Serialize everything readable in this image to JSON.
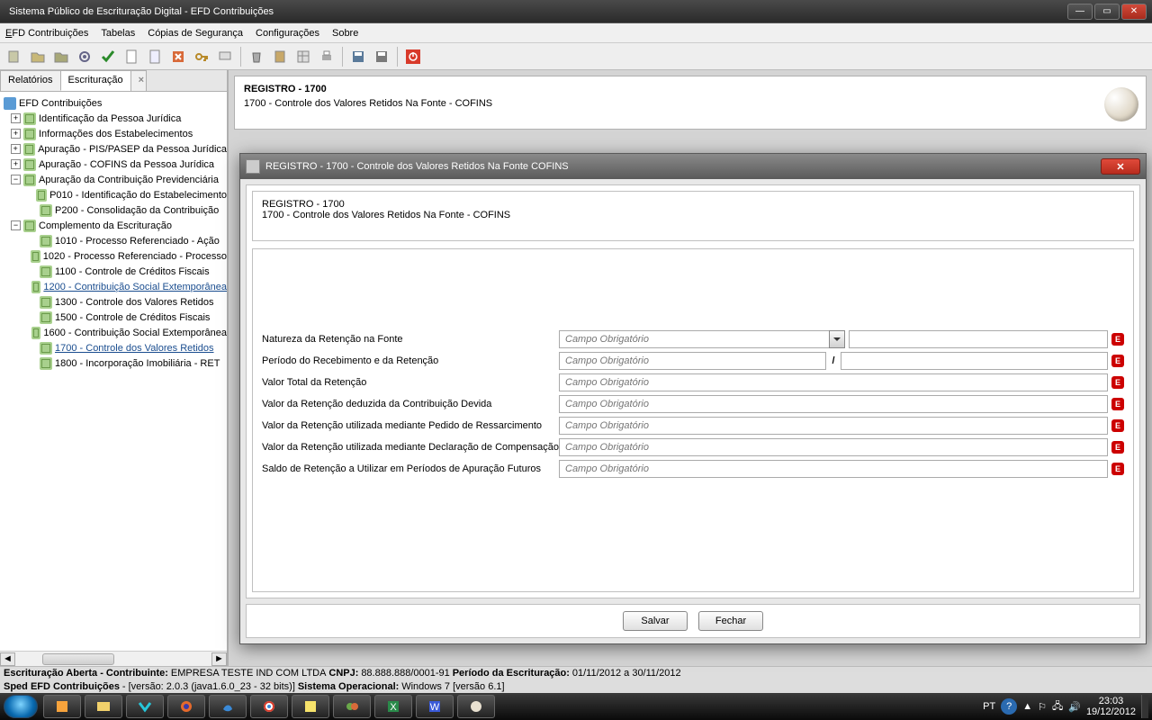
{
  "window": {
    "title": "Sistema Público de Escrituração Digital - EFD Contribuições"
  },
  "menu": {
    "m1": "EFD Contribuições",
    "m2": "Tabelas",
    "m3": "Cópias de Segurança",
    "m4": "Configurações",
    "m5": "Sobre"
  },
  "tabs": {
    "t1": "Relatórios",
    "t2": "Escrituração"
  },
  "tree": {
    "root": "EFD Contribuições",
    "n1": "Identificação da Pessoa Jurídica",
    "n2": "Informações dos Estabelecimentos",
    "n3": "Apuração - PIS/PASEP da Pessoa Jurídica",
    "n4": "Apuração - COFINS da Pessoa Jurídica",
    "n5": "Apuração da Contribuição Previdenciária",
    "n5a": "P010 - Identificação do Estabelecimento",
    "n5b": "P200 - Consolidação da Contribuição",
    "n6": "Complemento da Escrituração",
    "n6a": "1010 - Processo Referenciado - Ação",
    "n6b": "1020 - Processo Referenciado - Processo",
    "n6c": "1100 - Controle de Créditos Fiscais",
    "n6d": "1200 - Contribuição Social Extemporânea",
    "n6e": "1300 - Controle dos Valores Retidos",
    "n6f": "1500 - Controle de Créditos Fiscais",
    "n6g": "1600 - Contribuição Social Extemporânea",
    "n6h": "1700 - Controle dos Valores Retidos",
    "n6i": "1800 - Incorporação Imobiliária - RET"
  },
  "header": {
    "title": "REGISTRO - 1700",
    "sub": "1700 - Controle dos Valores Retidos Na Fonte - COFINS"
  },
  "dialog": {
    "title": "REGISTRO - 1700 - Controle dos Valores Retidos Na Fonte  COFINS",
    "hb_title": "REGISTRO - 1700",
    "hb_sub": "1700 - Controle dos Valores Retidos Na Fonte - COFINS",
    "labels": {
      "l1": "Natureza da Retenção na Fonte",
      "l2": "Período do Recebimento e da Retenção",
      "l3": "Valor Total da Retenção",
      "l4": "Valor da Retenção deduzida da Contribuição Devida",
      "l5": "Valor da Retenção utilizada mediante Pedido de Ressarcimento",
      "l6": "Valor da Retenção utilizada mediante Declaração de Compensação",
      "l7": "Saldo de Retenção a Utilizar em Períodos de Apuração Futuros"
    },
    "placeholder": "Campo Obrigatório",
    "slash": "/",
    "err": "E",
    "btn_save": "Salvar",
    "btn_close": "Fechar"
  },
  "status": {
    "line1_a": "Escrituração Aberta - Contribuinte:",
    "line1_b": "EMPRESA TESTE IND COM LTDA",
    "line1_c": "CNPJ:",
    "line1_d": "88.888.888/0001-91",
    "line1_e": "Período da Escrituração:",
    "line1_f": "01/11/2012 a 30/11/2012",
    "line2_a": "Sped EFD Contribuições",
    "line2_b": "- [versão: 2.0.3 (java1.6.0_23 - 32 bits)]",
    "line2_c": "Sistema Operacional:",
    "line2_d": "Windows 7 [versão 6.1]"
  },
  "taskbar": {
    "lang": "PT",
    "time": "23:03",
    "date": "19/12/2012"
  }
}
